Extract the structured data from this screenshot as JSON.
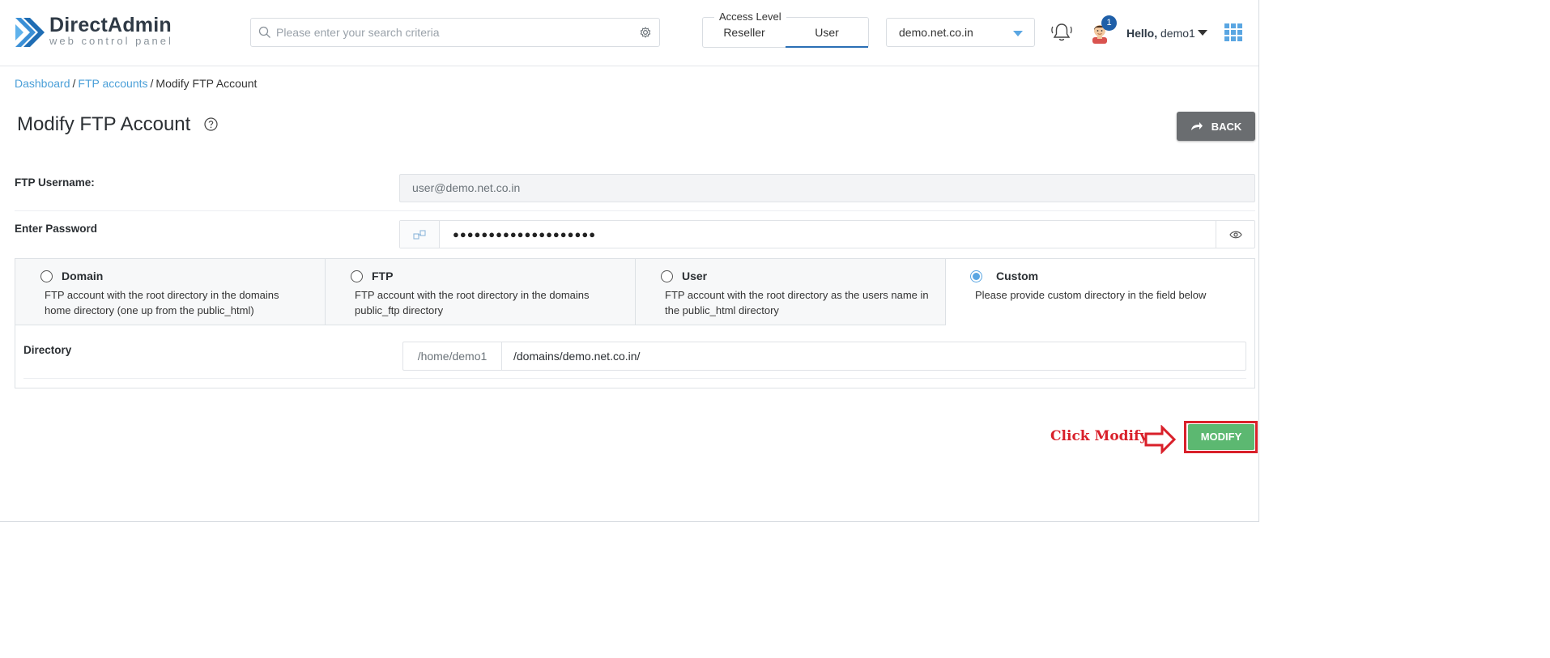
{
  "header": {
    "logo_title": "DirectAdmin",
    "logo_subtitle": "web control panel",
    "search_placeholder": "Please enter your search criteria",
    "access_level": {
      "legend": "Access Level",
      "tabs": [
        "Reseller",
        "User"
      ],
      "active": "User"
    },
    "domain_selected": "demo.net.co.in",
    "notification_count": "1",
    "greeting_prefix": "Hello,",
    "username": "demo1"
  },
  "breadcrumb": {
    "items": [
      "Dashboard",
      "FTP accounts"
    ],
    "current": "Modify FTP Account",
    "separator": "/"
  },
  "page": {
    "title": "Modify FTP Account",
    "back_label": "BACK"
  },
  "form": {
    "username_label": "FTP Username:",
    "username_value": "user@demo.net.co.in",
    "password_label": "Enter Password",
    "password_masked": "●●●●●●●●●●●●●●●●●●●●",
    "options": [
      {
        "title": "Domain",
        "desc": "FTP account with the root directory in the domains home directory (one up from the public_html)",
        "selected": false
      },
      {
        "title": "FTP",
        "desc": "FTP account with the root directory in the domains public_ftp directory",
        "selected": false
      },
      {
        "title": "User",
        "desc": "FTP account with the root directory as the users name in the public_html directory",
        "selected": false
      },
      {
        "title": "Custom",
        "desc": "Please provide custom directory in the field below",
        "selected": true
      }
    ],
    "directory_label": "Directory",
    "directory_prefix": "/home/demo1",
    "directory_value": "/domains/demo.net.co.in/"
  },
  "annotation": {
    "text": "Click Modify",
    "color": "#d9202a"
  },
  "actions": {
    "modify_label": "MODIFY"
  },
  "colors": {
    "accent": "#4a9fd8",
    "modify_green": "#5cb871",
    "back_gray": "#6a6d70",
    "badge_blue": "#1f5fa8"
  }
}
